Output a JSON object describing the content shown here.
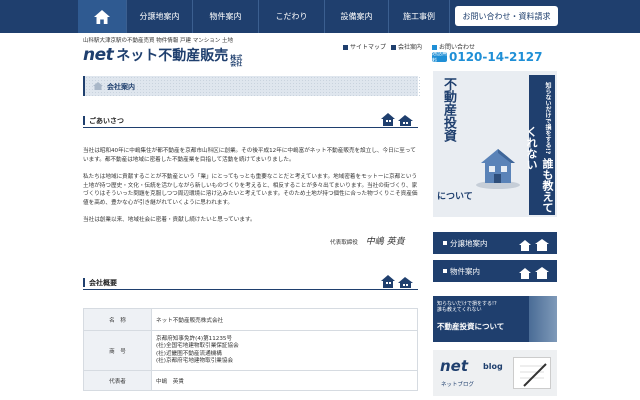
{
  "nav": {
    "items": [
      "分譲地案内",
      "物件案内",
      "こだわり",
      "設備案内",
      "施工事例"
    ],
    "contact": "お問い合わせ・資料請求"
  },
  "header": {
    "tagline": "山科駅大津京駅の不動産売買 物件情報 戸建 マンション 土地",
    "logo_net": "net",
    "logo_name": "ネット不動産販売",
    "logo_kk": "株式会社",
    "util_sitemap": "サイトマップ",
    "util_company": "会社案内",
    "util_contact": "お問い合わせ",
    "phone_badge": "通話無料",
    "phone": "0120-14-2127"
  },
  "main": {
    "page_title": "会社案内",
    "greeting_title": "ごあいさつ",
    "para1": "当社は昭和40年に中嶋集住が都不動産を京都市山科区に創業。その後平成12年に中嶋富がネット不動産販売を設立し、今日に至っています。都不動産は地域に密着した不動産業を目指して活動を続けてまいりました。",
    "para2": "私たちは地域に貢献することが不動産という「業」にとってもっとも重要なことだと考えています。地域密着をモットーに京都という土地が持つ歴史・文化・伝統を活かしながら新しいものづくりを考えると、相反することが多々出てまいります。当社の街づくり、家づくりはそういった問題を克服しつつ周辺環境に溶け込みたいと考えています。そのため土地が持つ個性に合った物づくりこそ資産価値を高め、豊かな心が引き継がれていくように思われます。",
    "para3": "当社は創業以来、地域社会に密着・貢献し続けたいと思っています。",
    "sign_title": "代表取締役",
    "sign_name": "中嶋 英貴",
    "overview_title": "会社概要",
    "table": [
      {
        "label": "名　称",
        "value": "ネット不動産販売株式会社"
      },
      {
        "label": "商　号",
        "value": "京都府知事免許(4)第11235号\n(社)全国宅地建物取引業保証協会\n(社)近畿圏不動産流通機構\n(社)京都府宅地建物取引業協会"
      },
      {
        "label": "代表者",
        "value": "中嶋　英貴"
      }
    ]
  },
  "sidebar": {
    "ad_vert1": "知らないだけで損をする!?",
    "ad_vert1b": "誰も教えてくれない",
    "ad_vert2": "不動産投資",
    "ad_bottom": "について",
    "btn1": "分譲地案内",
    "btn2": "物件案内",
    "ad2_line1": "知らないだけで損をする!?",
    "ad2_line2": "誰も教えてくれない",
    "ad2_title": "不動産投資について",
    "blog_net": "net",
    "blog_word": "blog",
    "blog_sub": "ネットブログ"
  },
  "colors": {
    "brand": "#1f3f6e",
    "accent": "#1f8fd6"
  }
}
